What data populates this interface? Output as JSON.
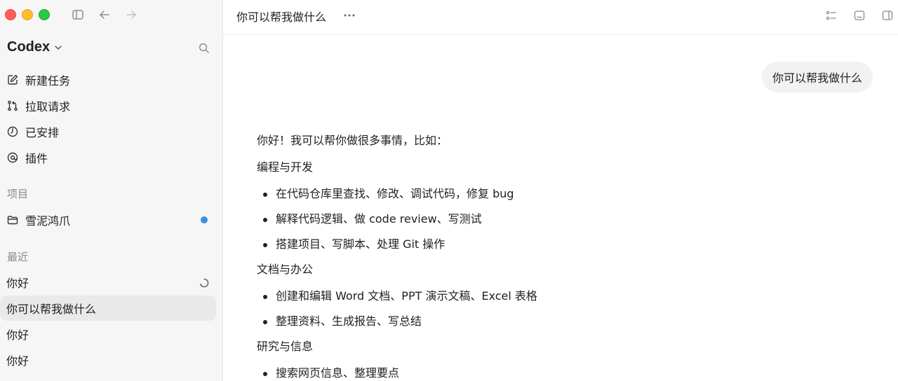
{
  "sidebar": {
    "brand": "Codex",
    "nav": [
      {
        "label": "新建任务",
        "icon": "edit-icon"
      },
      {
        "label": "拉取请求",
        "icon": "pull-request-icon"
      },
      {
        "label": "已安排",
        "icon": "clock-icon"
      },
      {
        "label": "插件",
        "icon": "plugin-icon"
      }
    ],
    "projects_label": "项目",
    "projects": [
      {
        "label": "雪泥鸿爪",
        "icon": "folder-icon"
      }
    ],
    "recent_label": "最近",
    "recent": [
      {
        "label": "你好"
      },
      {
        "label": "你可以帮我做什么"
      },
      {
        "label": "你好"
      },
      {
        "label": "你好"
      }
    ]
  },
  "main": {
    "title": "你可以帮我做什么",
    "user_message": "你可以帮我做什么",
    "reply": {
      "intro": "你好！我可以帮你做很多事情，比如：",
      "sections": [
        {
          "heading": "编程与开发",
          "items": [
            "在代码仓库里查找、修改、调试代码，修复 bug",
            "解释代码逻辑、做 code review、写测试",
            "搭建项目、写脚本、处理 Git 操作"
          ]
        },
        {
          "heading": "文档与办公",
          "items": [
            "创建和编辑 Word 文档、PPT 演示文稿、Excel 表格",
            "整理资料、生成报告、写总结"
          ]
        },
        {
          "heading": "研究与信息",
          "items": [
            "搜索网页信息、整理要点"
          ]
        }
      ]
    }
  },
  "colors": {
    "sidebar_bg": "#f6f6f6",
    "active_item": "#e9e9e9",
    "bubble_bg": "#f2f2f2",
    "project_dot": "#3b8fe5"
  }
}
